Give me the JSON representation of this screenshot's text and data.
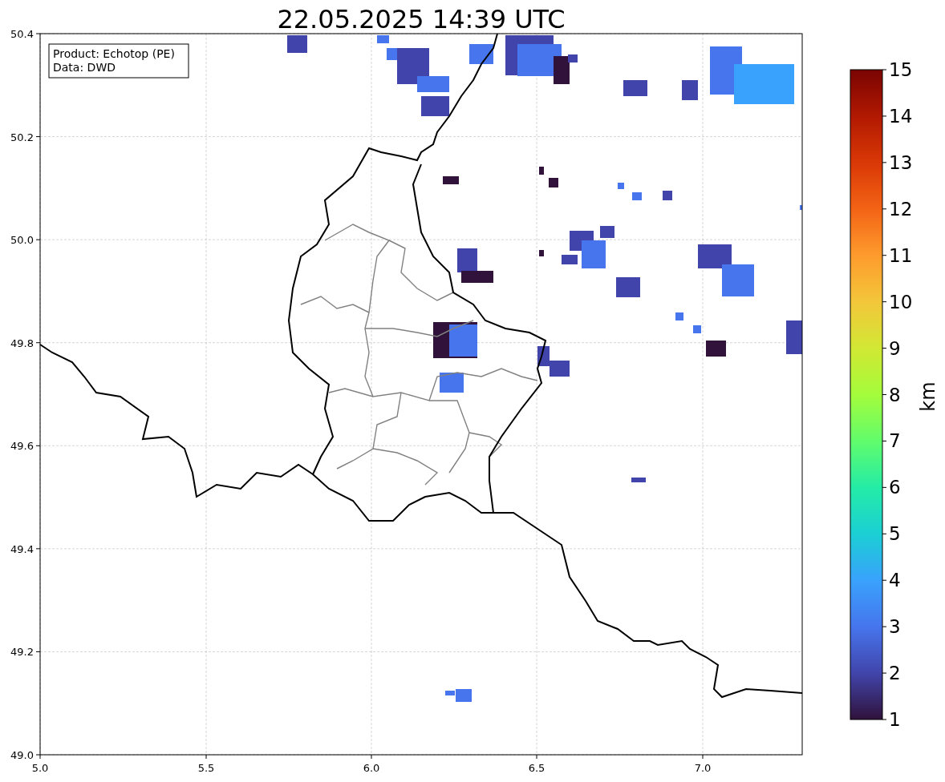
{
  "title": "22.05.2025 14:39 UTC",
  "info_box": [
    "Product: Echotop (PE)",
    "Data: DWD"
  ],
  "x_ticks": [
    "5.0",
    "5.5",
    "6.0",
    "6.5",
    "7.0"
  ],
  "y_ticks": [
    "50.4",
    "50.2",
    "50.0",
    "49.8",
    "49.6",
    "49.4",
    "49.2",
    "49.0"
  ],
  "colorbar": {
    "label": "km",
    "ticks": [
      "15",
      "14",
      "13",
      "12",
      "11",
      "10",
      "9",
      "8",
      "7",
      "6",
      "5",
      "4",
      "3",
      "2",
      "1"
    ]
  }
}
